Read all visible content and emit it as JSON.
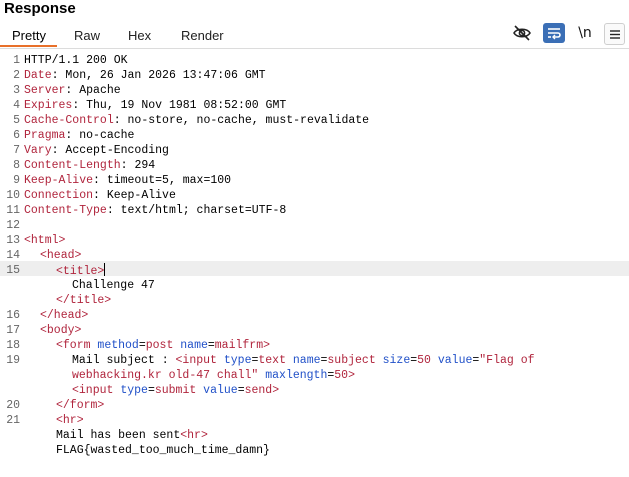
{
  "panel": {
    "title": "Response"
  },
  "tabs": [
    {
      "label": "Pretty",
      "active": true
    },
    {
      "label": "Raw",
      "active": false
    },
    {
      "label": "Hex",
      "active": false
    },
    {
      "label": "Render",
      "active": false
    }
  ],
  "toolbar": {
    "hide_icon": "eye-slash-icon",
    "wrap_icon": "word-wrap-icon",
    "newline_label": "\\n",
    "menu_icon": "hamburger-menu-icon",
    "accent_color": "#3b6fb6",
    "active_tab_color": "#e8702a"
  },
  "response": {
    "status_line": "HTTP/1.1 200 OK",
    "headers": [
      {
        "key": "Date",
        "value": "Mon, 26 Jan 2026 13:47:06 GMT"
      },
      {
        "key": "Server",
        "value": "Apache"
      },
      {
        "key": "Expires",
        "value": "Thu, 19 Nov 1981 08:52:00 GMT"
      },
      {
        "key": "Cache-Control",
        "value": "no-store, no-cache, must-revalidate"
      },
      {
        "key": "Pragma",
        "value": "no-cache"
      },
      {
        "key": "Vary",
        "value": "Accept-Encoding"
      },
      {
        "key": "Content-Length",
        "value": "294"
      },
      {
        "key": "Keep-Alive",
        "value": "timeout=5, max=100"
      },
      {
        "key": "Connection",
        "value": "Keep-Alive"
      },
      {
        "key": "Content-Type",
        "value": "text/html; charset=UTF-8"
      }
    ],
    "body": {
      "html_open": "<html>",
      "head_open": "<head>",
      "title_open": "<title>",
      "title_text": "Challenge 47",
      "title_close": "</title>",
      "head_close": "</head>",
      "body_open": "<body>",
      "form_tag_open": "<form",
      "form_attr1_name": "method",
      "form_attr1_value": "post",
      "form_attr2_name": "name",
      "form_attr2_value": "mailfrm",
      "form_tag_end": ">",
      "mail_subject_text": "Mail subject : ",
      "input1_tag": "<input",
      "input1_type_name": "type",
      "input1_type_value": "text",
      "input1_name_name": "name",
      "input1_name_value": "subject",
      "input1_size_name": "size",
      "input1_size_value": "50",
      "input1_value_name": "value",
      "input1_value_part1": "\"Flag of",
      "input1_value_part2": "webhacking.kr old-47 chall\"",
      "input1_maxlength_name": "maxlength",
      "input1_maxlength_value": "50",
      "input1_end": ">",
      "input2_tag": "<input",
      "input2_type_name": "type",
      "input2_type_value": "submit",
      "input2_value_name": "value",
      "input2_value_value": "send",
      "input2_end": ">",
      "form_close": "</form>",
      "hr1": "<hr>",
      "mail_sent_text": "Mail has been sent",
      "hr2": "<hr>",
      "flag_text": "FLAG{wasted_too_much_time_damn}"
    },
    "line_numbers": [
      "1",
      "2",
      "3",
      "4",
      "5",
      "6",
      "7",
      "8",
      "9",
      "10",
      "11",
      "12",
      "13",
      "14",
      "15",
      "16",
      "17",
      "18",
      "19",
      "20",
      "21"
    ]
  }
}
